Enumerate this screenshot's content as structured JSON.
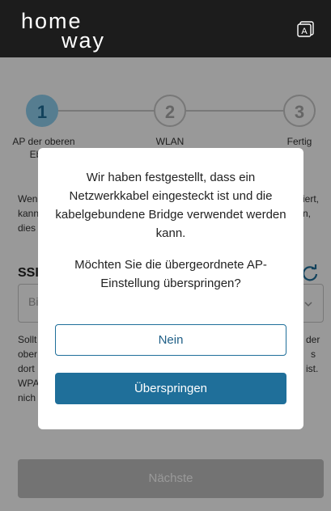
{
  "header": {
    "logo_line1": "home",
    "logo_line2": "way",
    "icon": "language-a-icon",
    "icon_letter": "A"
  },
  "stepper": {
    "steps": [
      {
        "number": "1",
        "label": "AP der oberen Ebene",
        "state": "active"
      },
      {
        "number": "2",
        "label": "WLAN",
        "state": "inactive"
      },
      {
        "number": "3",
        "label": "Fertig",
        "state": "inactive"
      }
    ]
  },
  "background": {
    "intro_fragments": [
      "Wen",
      "kann",
      "dies"
    ],
    "intro_right_fragments": [
      "iert,",
      "n,"
    ],
    "ssid_label": "SSI",
    "ssid_placeholder": "Bi",
    "note_fragments": [
      "Sollt",
      "ober",
      "dort",
      "WPA",
      "nich"
    ],
    "note_right_fragments": [
      "der",
      "s",
      "ist."
    ],
    "next_button": "Nächste"
  },
  "dialog": {
    "message": "Wir haben festgestellt, dass ein Netzwerkkabel eingesteckt ist und die kabelgebundene Bridge verwendet werden kann.",
    "question": "Möchten Sie die übergeordnete AP-Einstellung überspringen?",
    "no_button": "Nein",
    "skip_button": "Überspringen"
  },
  "colors": {
    "header_bg": "#1c1c1c",
    "primary": "#1f6f9a",
    "step_active": "#8fd0f0",
    "disabled": "#c0c0c0"
  }
}
